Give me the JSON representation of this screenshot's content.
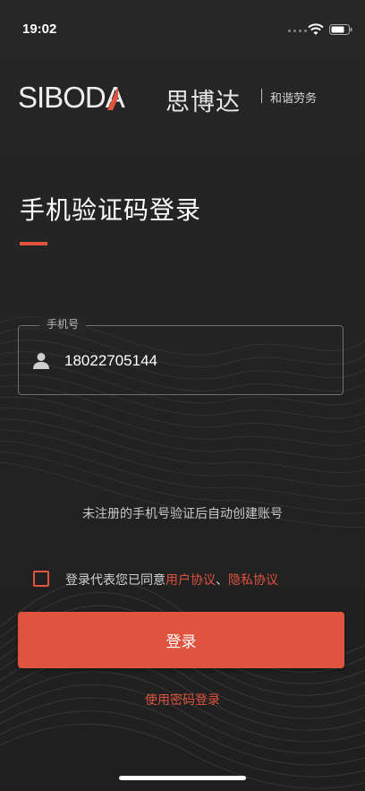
{
  "status_bar": {
    "time": "19:02"
  },
  "brand": {
    "logo_text": "SIBODA",
    "chinese_name": "思博达",
    "subtitle": "和谐劳务"
  },
  "page": {
    "title": "手机验证码登录"
  },
  "phone_field": {
    "label": "手机号",
    "value": "18022705144",
    "icon": "user-icon"
  },
  "hint": "未注册的手机号验证后自动创建账号",
  "agreement": {
    "checked": false,
    "prefix": "登录代表您已同意",
    "user_agreement": "用户协议",
    "separator": "、",
    "privacy_policy": "隐私协议"
  },
  "login_button": {
    "label": "登录"
  },
  "password_login_link": "使用密码登录",
  "colors": {
    "accent": "#e0533f",
    "background": "#232323",
    "text": "#ffffff",
    "muted_text": "#c8c8c8"
  }
}
